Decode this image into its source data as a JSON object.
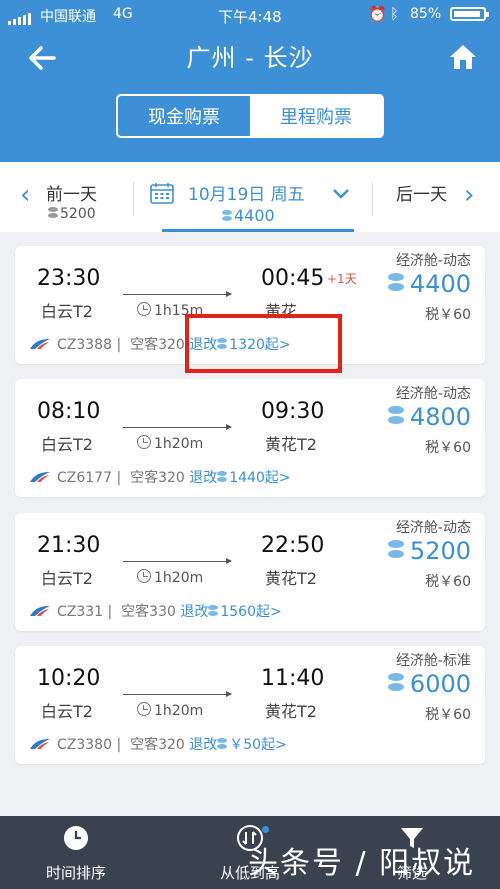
{
  "status": {
    "carrier": "中国联通",
    "network": "4G",
    "time": "下午4:48",
    "battery": "85%"
  },
  "header": {
    "title": "广州 - 长沙",
    "tabs": [
      "现金购票",
      "里程购票"
    ],
    "active_tab": "里程购票"
  },
  "datebar": {
    "prev": {
      "label": "前一天",
      "price": "5200"
    },
    "current": {
      "label": "10月19日 周五",
      "price": "4400"
    },
    "next": {
      "label": "后一天"
    }
  },
  "flights": [
    {
      "dep_time": "23:30",
      "dep_airport": "白云T2",
      "arr_time": "00:45",
      "plus_day": "+1天",
      "arr_airport": "黄花",
      "duration": "1h15m",
      "cabin": "经济舱-动态",
      "price": "4400",
      "tax": "税￥60",
      "flight_no": "CZ3388",
      "aircraft": "空客320",
      "change_label": "退改",
      "change_fee": "1320起>"
    },
    {
      "dep_time": "08:10",
      "dep_airport": "白云T2",
      "arr_time": "09:30",
      "plus_day": "",
      "arr_airport": "黄花T2",
      "duration": "1h20m",
      "cabin": "经济舱-动态",
      "price": "4800",
      "tax": "税￥60",
      "flight_no": "CZ6177",
      "aircraft": "空客320",
      "change_label": "退改",
      "change_fee": "1440起>"
    },
    {
      "dep_time": "21:30",
      "dep_airport": "白云T2",
      "arr_time": "22:50",
      "plus_day": "",
      "arr_airport": "黄花T2",
      "duration": "1h20m",
      "cabin": "经济舱-动态",
      "price": "5200",
      "tax": "税￥60",
      "flight_no": "CZ331",
      "aircraft": "空客330",
      "change_label": "退改",
      "change_fee": "1560起>"
    },
    {
      "dep_time": "10:20",
      "dep_airport": "白云T2",
      "arr_time": "11:40",
      "plus_day": "",
      "arr_airport": "黄花T2",
      "duration": "1h20m",
      "cabin": "经济舱-标准",
      "price": "6000",
      "tax": "税￥60",
      "flight_no": "CZ3380",
      "aircraft": "空客320",
      "change_label": "退改",
      "change_fee": "￥50起>"
    }
  ],
  "bottom": {
    "sort_time": "时间排序",
    "sort_price": "从低到高",
    "filter": "筛选",
    "watermark": "头条号 / 阳叔说"
  },
  "colors": {
    "brand": "#3d8fd6",
    "highlight": "#e3221b",
    "bottom_bar": "#3a4250"
  }
}
